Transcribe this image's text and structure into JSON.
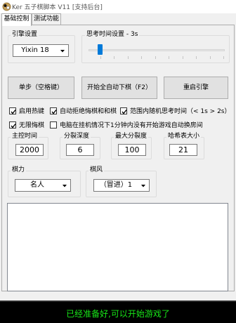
{
  "window": {
    "title": "Ker 五子棋脚本 V11 [支持后台]",
    "icon": "gomoku-app-icon"
  },
  "tabs": [
    {
      "label": "基础控制",
      "active": true
    },
    {
      "label": "测试功能",
      "active": false
    }
  ],
  "engine": {
    "group_label": "引擎设置",
    "selected": "Yixin 18"
  },
  "think_time": {
    "group_label": "思考时间设置 - 3s",
    "ticks": 10
  },
  "buttons": {
    "single_step": "单步（空格键）",
    "auto_play": "开始全自动下棋（F2）",
    "restart_engine": "重启引擎"
  },
  "options": [
    {
      "label": "启用热键",
      "checked": true
    },
    {
      "label": "自动拒绝悔棋和和棋",
      "checked": true
    },
    {
      "label": "范围内随机思考时间（< 1s  >  2s）",
      "checked": true
    },
    {
      "label": "无限悔棋",
      "checked": true
    },
    {
      "label": "电脑在挂机情况下1分钟内没有开始游戏自动换房间",
      "checked": false
    }
  ],
  "params": [
    {
      "label": "主控时间",
      "value": "2000"
    },
    {
      "label": "分裂深度",
      "value": "6"
    },
    {
      "label": "最大分裂度",
      "value": "100"
    },
    {
      "label": "哈希表大小",
      "value": "21"
    }
  ],
  "strength": {
    "group_label": "棋力",
    "selected": "名人"
  },
  "style": {
    "group_label": "棋风",
    "selected": "（冒进）1"
  },
  "log_text": "",
  "status": {
    "text": "已经准备好,可以开始游戏了",
    "color": "#18e618",
    "background": "#000000"
  },
  "colors": {
    "slider_thumb": "#007ad9",
    "window_bg": "#f0f0f0"
  }
}
